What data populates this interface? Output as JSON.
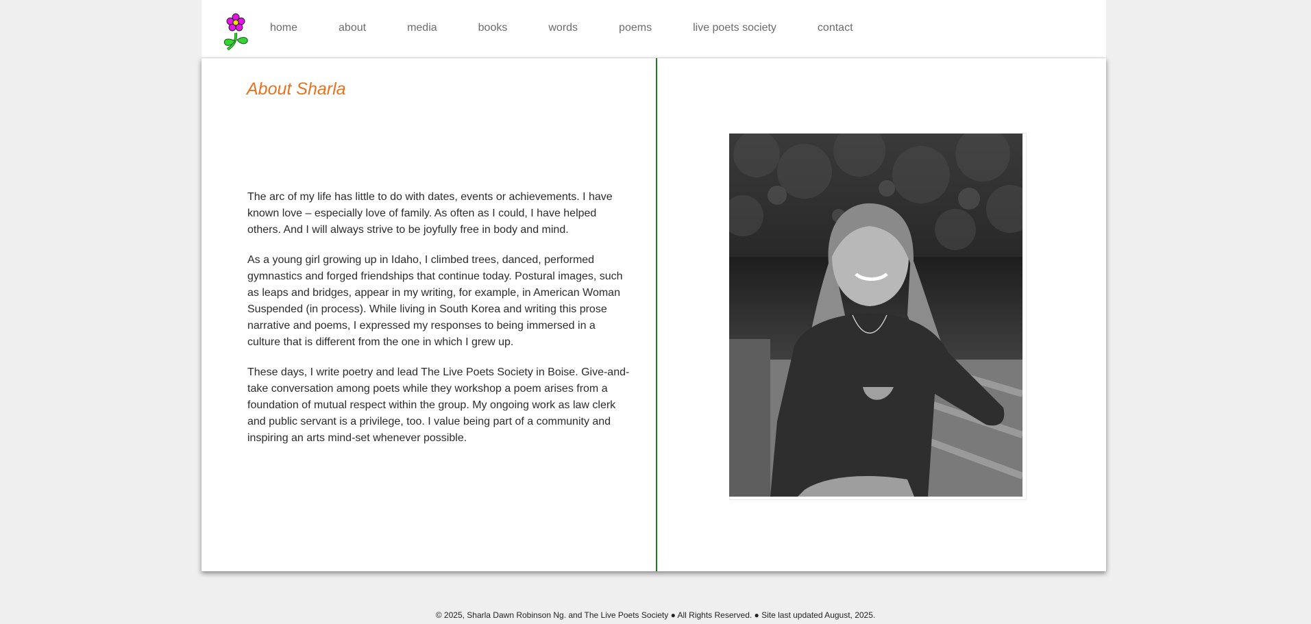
{
  "nav": {
    "items": [
      {
        "label": "home"
      },
      {
        "label": "about"
      },
      {
        "label": "media"
      },
      {
        "label": "books"
      },
      {
        "label": "words"
      },
      {
        "label": "poems"
      },
      {
        "label": "live poets society"
      },
      {
        "label": "contact"
      }
    ]
  },
  "logo": {
    "icon": "flower-icon",
    "petal_color": "#e614e6",
    "stem_color": "#2ecc2e"
  },
  "main": {
    "title": "About Sharla",
    "paragraphs": [
      "The arc of my life has little to do with dates, events or achievements. I have known love – especially love of family. As often as I could, I have helped others. And I will always strive to be joyfully free in body and mind.",
      "As a young girl growing up in Idaho, I climbed trees, danced, performed gymnastics and forged friendships that continue today. Postural images, such as leaps and bridges, appear in my writing, for example, in American Woman Suspended (in process). While living in South Korea and writing this prose narrative and poems, I expressed my responses to being immersed in a culture that is different from the one in which I grew up.",
      "These days, I write poetry and lead The Live Poets Society in Boise. Give-and-take conversation among poets while they workshop a poem arises from a foundation of mutual respect within the group. My ongoing work as law clerk and public servant is a privilege, too. I value being part of a community and inspiring an arts mind-set whenever possible."
    ]
  },
  "colors": {
    "accent": "#e8721e",
    "divider": "#1e7a1e"
  },
  "footer": {
    "text": "© 2025, Sharla Dawn Robinson Ng. and The Live Poets Society ● All Rights Reserved. ● Site last updated August, 2025."
  }
}
